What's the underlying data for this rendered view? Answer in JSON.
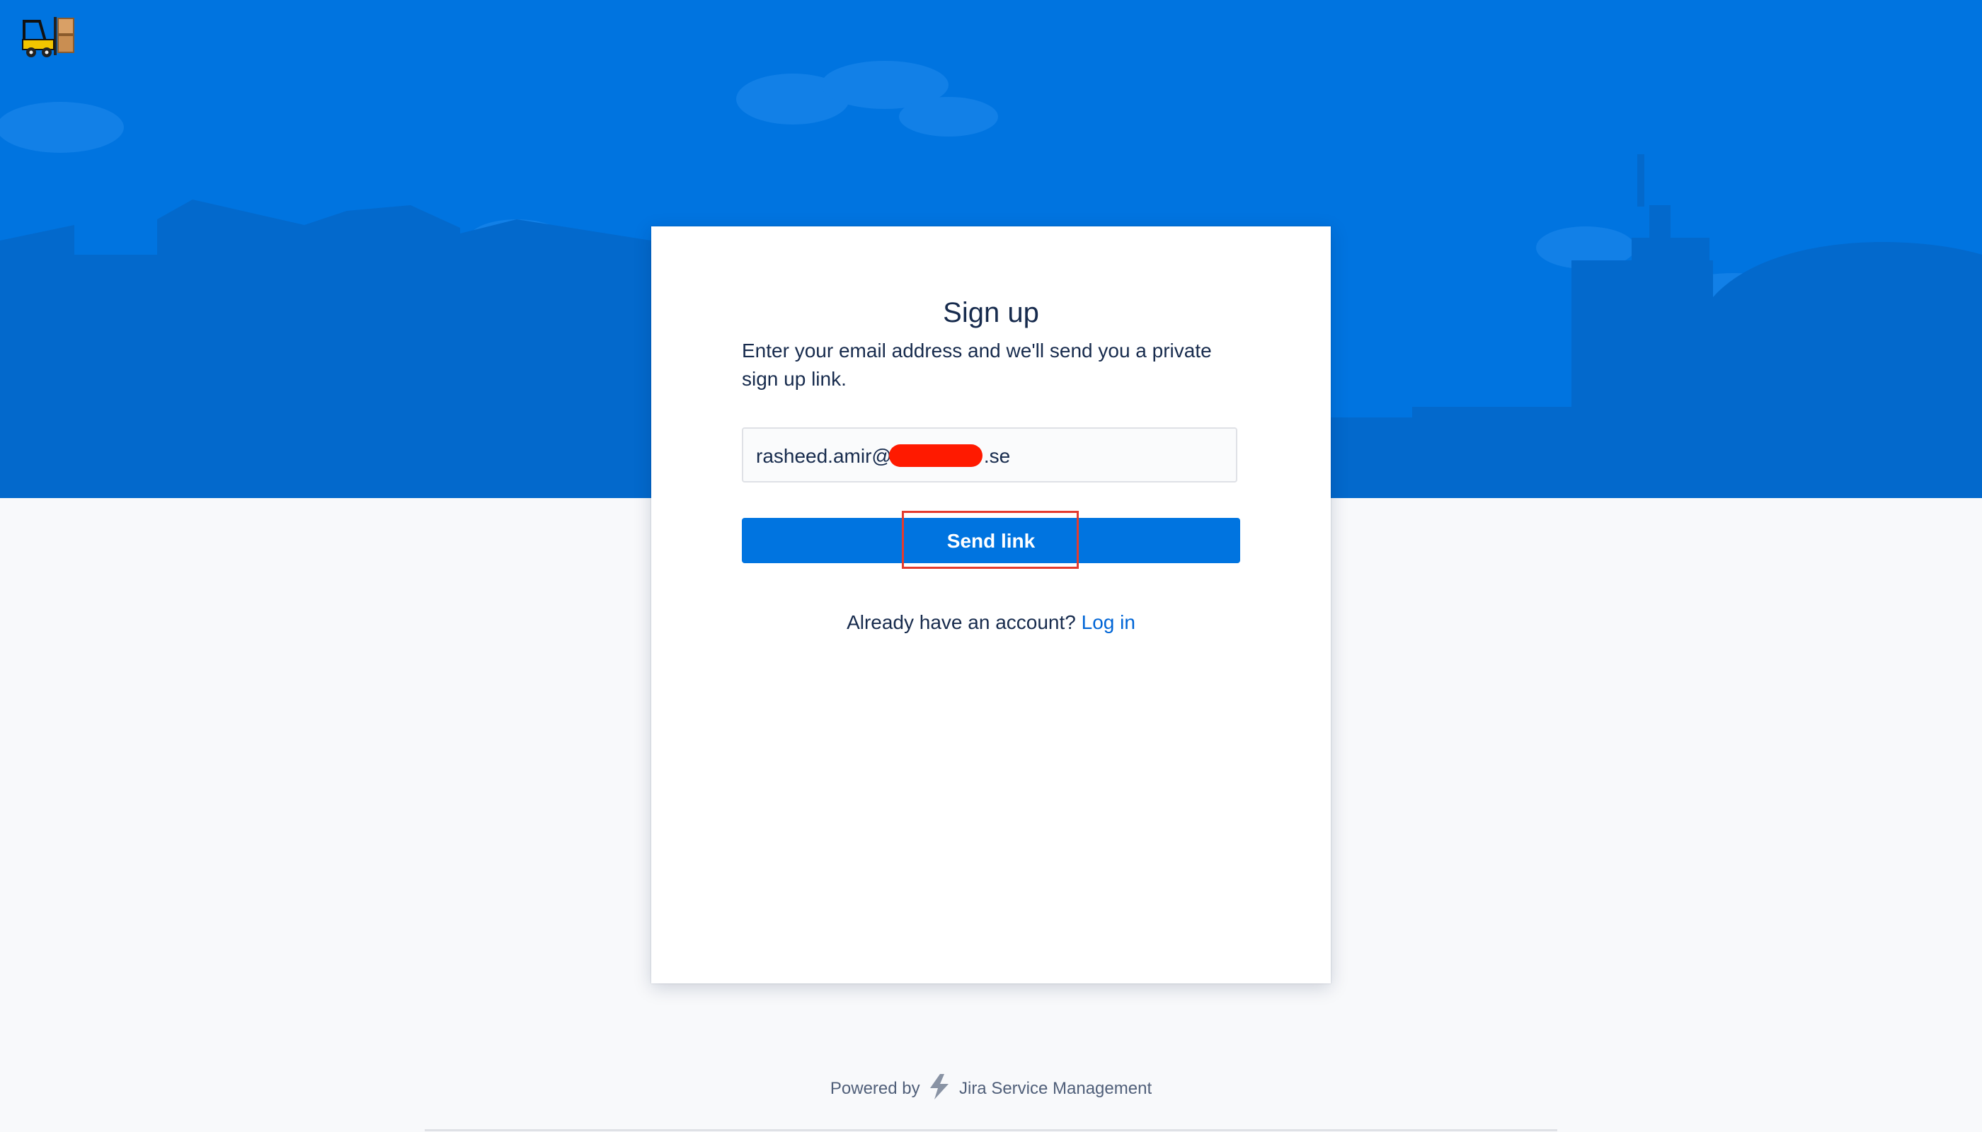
{
  "brand": {
    "logo_icon": "forklift-logo-icon"
  },
  "signup": {
    "title": "Sign up",
    "description": "Enter your email address and we'll send you a private sign up link.",
    "email_prefix": "rasheed.amir@",
    "email_suffix": ".se",
    "send_button_label": "Send link",
    "already_text": "Already have an account?",
    "login_link_label": "Log in"
  },
  "footer": {
    "powered_by": "Powered by",
    "product_name": "Jira Service Management",
    "product_icon": "lightning-bolt-icon"
  },
  "colors": {
    "hero_background": "#0074e0",
    "button_background": "#0074e0",
    "link": "#0065d6",
    "highlight_border": "#e33b2e",
    "redaction": "#ff1a00",
    "page_background": "#f8f9fb"
  }
}
